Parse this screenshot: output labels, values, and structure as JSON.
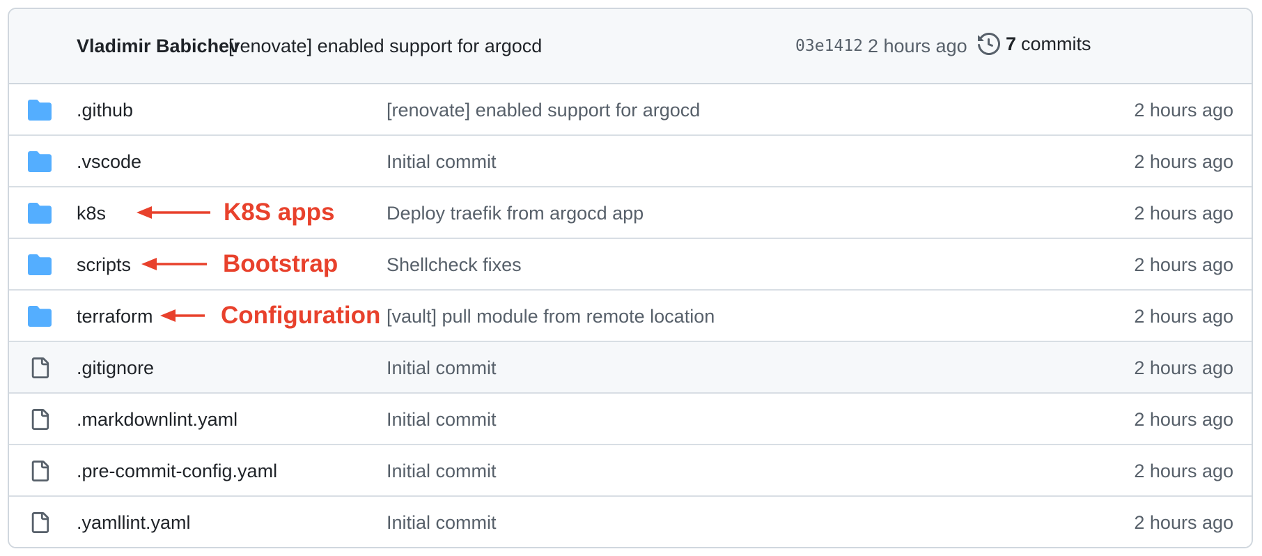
{
  "last_commit": {
    "author": "Vladimir Babichev",
    "message": "[renovate] enabled support for argocd",
    "sha": "03e1412",
    "time": "2 hours ago",
    "commit_count": "7",
    "commits_label": "commits",
    "history_icon": "history-icon"
  },
  "files": [
    {
      "type": "folder",
      "icon": "folder-icon",
      "name": ".github",
      "message": "[renovate] enabled support for argocd",
      "time": "2 hours ago"
    },
    {
      "type": "folder",
      "icon": "folder-icon",
      "name": ".vscode",
      "message": "Initial commit",
      "time": "2 hours ago"
    },
    {
      "type": "folder",
      "icon": "folder-icon",
      "name": "k8s",
      "message": "Deploy traefik from argocd app",
      "time": "2 hours ago",
      "annotation": "K8S apps"
    },
    {
      "type": "folder",
      "icon": "folder-icon",
      "name": "scripts",
      "message": "Shellcheck fixes",
      "time": "2 hours ago",
      "annotation": "Bootstrap"
    },
    {
      "type": "folder",
      "icon": "folder-icon",
      "name": "terraform",
      "message": "[vault] pull module from remote location",
      "time": "2 hours ago",
      "annotation": "Configuration"
    },
    {
      "type": "file",
      "icon": "file-icon",
      "name": ".gitignore",
      "message": "Initial commit",
      "time": "2 hours ago"
    },
    {
      "type": "file",
      "icon": "file-icon",
      "name": ".markdownlint.yaml",
      "message": "Initial commit",
      "time": "2 hours ago"
    },
    {
      "type": "file",
      "icon": "file-icon",
      "name": ".pre-commit-config.yaml",
      "message": "Initial commit",
      "time": "2 hours ago"
    },
    {
      "type": "file",
      "icon": "file-icon",
      "name": ".yamllint.yaml",
      "message": "Initial commit",
      "time": "2 hours ago"
    }
  ],
  "colors": {
    "folder": "#54aeff",
    "annotation": "#e8412c",
    "muted_text": "#57606a",
    "border": "#d0d7de",
    "header_bg": "#f6f8fa"
  }
}
